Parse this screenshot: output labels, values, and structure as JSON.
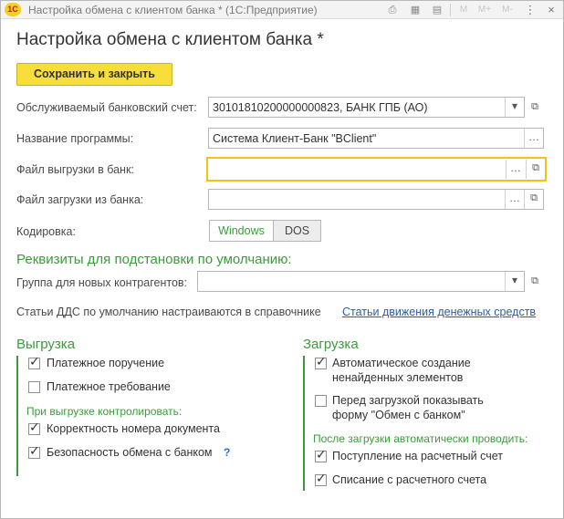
{
  "window": {
    "logo": "1С",
    "title": "Настройка обмена с клиентом банка * (1С:Предприятие)",
    "memory_buttons": [
      "M",
      "M+",
      "M-"
    ]
  },
  "form": {
    "title": "Настройка обмена с клиентом банка *",
    "save_button": "Сохранить и закрыть",
    "bank_account": {
      "label": "Обслуживаемый банковский счет:",
      "value": "30101810200000000823, БАНК ГПБ (АО)"
    },
    "program_name": {
      "label": "Название программы:",
      "value": "Система Клиент-Банк \"BClient\""
    },
    "export_file": {
      "label": "Файл выгрузки в банк:",
      "value": ""
    },
    "import_file": {
      "label": "Файл загрузки из банка:",
      "value": ""
    },
    "encoding": {
      "label": "Кодировка:",
      "options": [
        "Windows",
        "DOS"
      ],
      "selected": "Windows"
    },
    "defaults": {
      "title": "Реквизиты для подстановки по умолчанию:",
      "group_label": "Группа для новых контрагентов:",
      "group_value": "",
      "dds_note": "Статьи ДДС по умолчанию настраиваются в справочнике",
      "dds_link": "Статьи движения денежных средств"
    },
    "export": {
      "title": "Выгрузка",
      "payment_order": {
        "label": "Платежное поручение",
        "checked": true
      },
      "payment_request": {
        "label": "Платежное требование",
        "checked": false
      },
      "control_title": "При выгрузке контролировать:",
      "doc_number": {
        "label": "Корректность номера документа",
        "checked": true
      },
      "security": {
        "label": "Безопасность обмена с банком",
        "checked": true
      },
      "help": "?"
    },
    "import": {
      "title": "Загрузка",
      "auto_create": {
        "label_line1": "Автоматическое создание",
        "label_line2": "ненайденных элементов",
        "checked": true
      },
      "show_form": {
        "label_line1": "Перед загрузкой показывать",
        "label_line2": "форму \"Обмен с банком\"",
        "checked": false
      },
      "auto_post_title": "После загрузки автоматически проводить:",
      "receipt": {
        "label": "Поступление на расчетный счет",
        "checked": true
      },
      "writeoff": {
        "label": "Списание с расчетного счета",
        "checked": true
      }
    }
  }
}
